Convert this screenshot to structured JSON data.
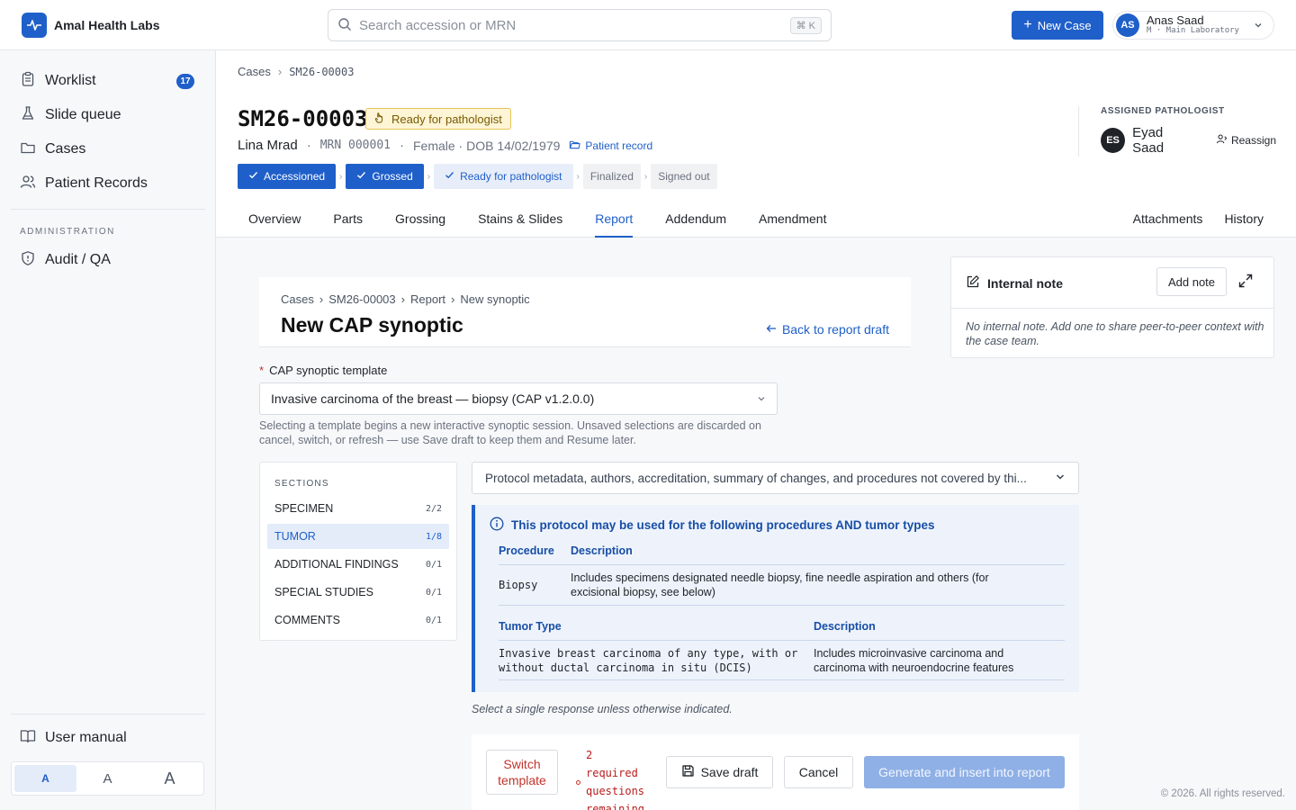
{
  "header": {
    "brand": "Amal Health Labs",
    "search_placeholder": "Search accession or MRN",
    "search_shortcut": "⌘ K",
    "new_case": "New Case",
    "user": {
      "initials": "AS",
      "name": "Anas Saad",
      "sub": "M · Main Laboratory"
    }
  },
  "sidebar": {
    "items": [
      {
        "label": "Worklist",
        "badge": "17"
      },
      {
        "label": "Slide queue"
      },
      {
        "label": "Cases"
      },
      {
        "label": "Patient Records"
      }
    ],
    "admin_title": "ADMINISTRATION",
    "admin_items": [
      {
        "label": "Audit / QA"
      }
    ],
    "user_manual": "User manual",
    "font_sizes": [
      "A",
      "A",
      "A"
    ]
  },
  "case": {
    "breadcrumb": [
      "Cases",
      "SM26-00003"
    ],
    "id": "SM26-00003",
    "status": "Ready for pathologist",
    "patient_name": "Lina Mrad",
    "mrn": "MRN 000001",
    "demographics": "Female · DOB 14/02/1979",
    "patient_record": "Patient record",
    "steps": [
      {
        "label": "Accessioned",
        "state": "done"
      },
      {
        "label": "Grossed",
        "state": "done"
      },
      {
        "label": "Ready for pathologist",
        "state": "current"
      },
      {
        "label": "Finalized",
        "state": "todo"
      },
      {
        "label": "Signed out",
        "state": "todo"
      }
    ],
    "pathologist_label": "ASSIGNED PATHOLOGIST",
    "pathologist_initials": "ES",
    "pathologist_name": "Eyad Saad",
    "reassign": "Reassign"
  },
  "tabs": {
    "left": [
      "Overview",
      "Parts",
      "Grossing",
      "Stains & Slides",
      "Report",
      "Addendum",
      "Amendment"
    ],
    "right": [
      "Attachments",
      "History"
    ],
    "active": "Report"
  },
  "synoptic": {
    "breadcrumb": [
      "Cases",
      "SM26-00003",
      "Report",
      "New synoptic"
    ],
    "title": "New CAP synoptic",
    "back": "Back to report draft",
    "template_label": "CAP synoptic template",
    "template_value": "Invasive carcinoma of the breast — biopsy (CAP v1.2.0.0)",
    "template_help": "Selecting a template begins a new interactive synoptic session. Unsaved selections are discarded on cancel, switch, or refresh — use Save draft to keep them and Resume later.",
    "sections_title": "SECTIONS",
    "sections": [
      {
        "label": "SPECIMEN",
        "count": "2/2"
      },
      {
        "label": "TUMOR",
        "count": "1/8"
      },
      {
        "label": "ADDITIONAL FINDINGS",
        "count": "0/1"
      },
      {
        "label": "SPECIAL STUDIES",
        "count": "0/1"
      },
      {
        "label": "COMMENTS",
        "count": "0/1"
      }
    ],
    "active_section": "TUMOR",
    "protocol_meta": "Protocol metadata, authors, accreditation, summary of changes, and procedures not covered by thi...",
    "info_title": "This protocol may be used for the following procedures AND tumor types",
    "procedure_head": [
      "Procedure",
      "Description"
    ],
    "procedure_rows": [
      {
        "name": "Biopsy",
        "desc": "Includes specimens designated needle biopsy, fine needle aspiration and others (for excisional biopsy, see below)"
      }
    ],
    "tumor_head": [
      "Tumor Type",
      "Description"
    ],
    "tumor_rows": [
      {
        "name": "Invasive breast carcinoma of any type, with or without ductal carcinoma in situ (DCIS)",
        "desc": "Includes microinvasive carcinoma and carcinoma with neuroendocrine features"
      }
    ],
    "footnote": "Select a single response unless otherwise indicated.",
    "switch_template": "Switch template",
    "remaining": "2 required questions remaining",
    "save_draft": "Save draft",
    "cancel": "Cancel",
    "generate": "Generate and insert into report"
  },
  "note": {
    "title": "Internal note",
    "add": "Add note",
    "empty": "No internal note. Add one to share peer-to-peer context with the case team."
  },
  "footer": {
    "copyright": "© 2026. All rights reserved."
  }
}
